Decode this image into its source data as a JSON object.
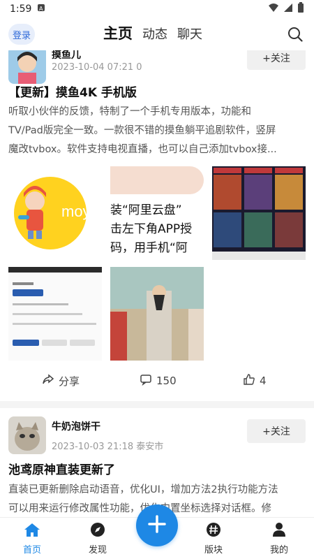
{
  "status_bar": {
    "time": "1:59"
  },
  "header": {
    "login_label": "登录",
    "tabs": [
      {
        "label": "主页",
        "active": true
      },
      {
        "label": "动态"
      },
      {
        "label": "聊天"
      }
    ]
  },
  "posts": [
    {
      "username": "摸鱼儿",
      "meta": "2023-10-04 07:21 0",
      "follow_label": "+关注",
      "title": "【更新】摸鱼4K 手机版",
      "body": [
        "听取小伙伴的反馈，特制了一个手机专用版本，功能和",
        "TV/Pad版完全一致。一款很不错的摸鱼躺平追剧软件，竖屏",
        "魔改tvbox。软件支持电视直播，也可以自己添加tvbox接..."
      ],
      "image_texts": {
        "logo_text": "moyu",
        "promo_lines": [
          "装“阿里云盘”",
          "击左下角APP授",
          "码，用手机“阿"
        ]
      },
      "actions": {
        "share": "分享",
        "comments": "150",
        "likes": "4"
      }
    },
    {
      "username": "牛奶泡饼干",
      "meta": "2023-10-03 21:18 泰安市",
      "follow_label": "+关注",
      "title": "池鸢原神直装更新了",
      "body": [
        "直装已更新删除启动语音，优化UI，增加方法2执行功能方法",
        "可以用来运行修改属性功能，优化内置坐标选择对话框。修"
      ]
    }
  ],
  "bottom_nav": [
    {
      "label": "首页",
      "icon": "home-icon",
      "active": true
    },
    {
      "label": "发现",
      "icon": "compass-icon"
    },
    {
      "label": "版块",
      "icon": "hashtag-icon"
    },
    {
      "label": "我的",
      "icon": "person-icon"
    }
  ],
  "colors": {
    "accent": "#1e88e5",
    "login_bg": "#e7eefb"
  }
}
